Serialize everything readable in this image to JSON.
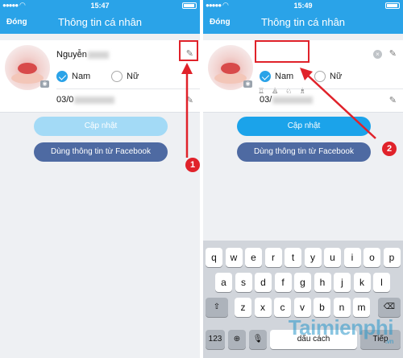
{
  "left": {
    "status": {
      "time": "15:47"
    },
    "nav": {
      "close": "Đóng",
      "title": "Thông tin cá nhân"
    },
    "profile": {
      "name": "Nguyễn",
      "gender_male": "Nam",
      "gender_female": "Nữ",
      "dob": "03/0"
    },
    "buttons": {
      "update": "Cập nhật",
      "facebook": "Dùng thông tin từ Facebook"
    },
    "badge": "1"
  },
  "right": {
    "status": {
      "time": "15:49"
    },
    "nav": {
      "close": "Đóng",
      "title": "Thông tin cá nhân"
    },
    "profile": {
      "gender_male": "Nam",
      "gender_female": "Nữ",
      "dob": "03/"
    },
    "buttons": {
      "update": "Cập nhật",
      "facebook": "Dùng thông tin từ Facebook"
    },
    "badge": "2",
    "keyboard": {
      "row1": [
        "q",
        "w",
        "e",
        "r",
        "t",
        "y",
        "u",
        "i",
        "o",
        "p"
      ],
      "row2": [
        "a",
        "s",
        "d",
        "f",
        "g",
        "h",
        "j",
        "k",
        "l"
      ],
      "row3": [
        "z",
        "x",
        "c",
        "v",
        "b",
        "n",
        "m"
      ],
      "num": "123",
      "space": "dấu cách",
      "return": "Tiếp"
    }
  },
  "watermark": {
    "brand": "Taimienphi",
    "domain": ".vn"
  },
  "colors": {
    "accent": "#2aa3e8",
    "facebook": "#4e6aa2",
    "marker": "#e0222a",
    "keyboard": "#d1d5db"
  }
}
